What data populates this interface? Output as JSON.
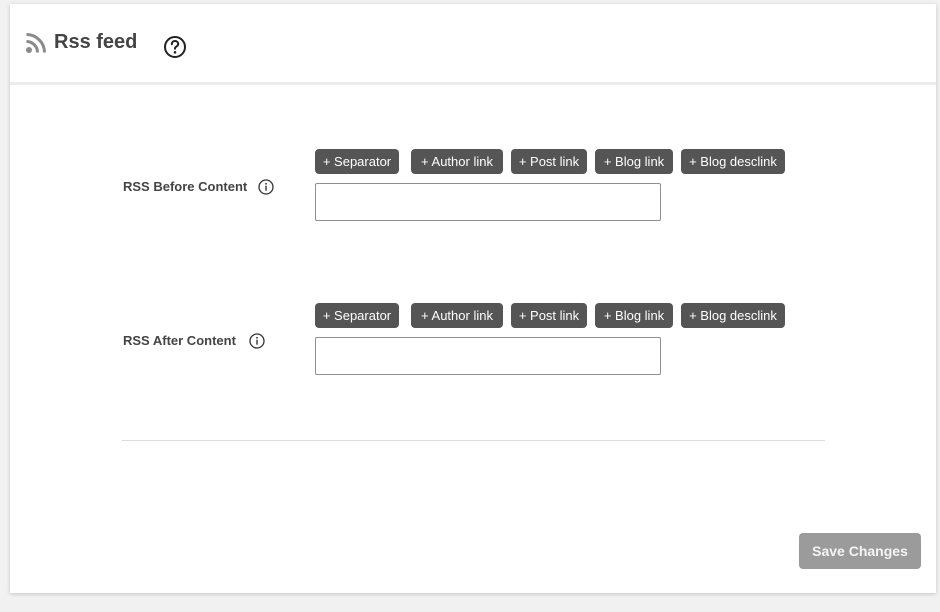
{
  "header": {
    "title": "Rss feed",
    "rss_icon": "rss-feed-icon",
    "help_icon": "question-circle-icon"
  },
  "fields": [
    {
      "label": "RSS Before Content",
      "info_icon": "info-circle-icon",
      "tags": [
        "+ Separator",
        "+ Author link",
        "+ Post link",
        "+ Blog link",
        "+ Blog desclink"
      ],
      "value": ""
    },
    {
      "label": "RSS After Content",
      "info_icon": "info-circle-icon",
      "tags": [
        "+ Separator",
        "+ Author link",
        "+ Post link",
        "+ Blog link",
        "+ Blog desclink"
      ],
      "value": ""
    }
  ],
  "footer": {
    "save_label": "Save Changes"
  },
  "colors": {
    "tag_bg": "#555555",
    "save_bg": "#9b9b9b",
    "icon": "#888888"
  }
}
